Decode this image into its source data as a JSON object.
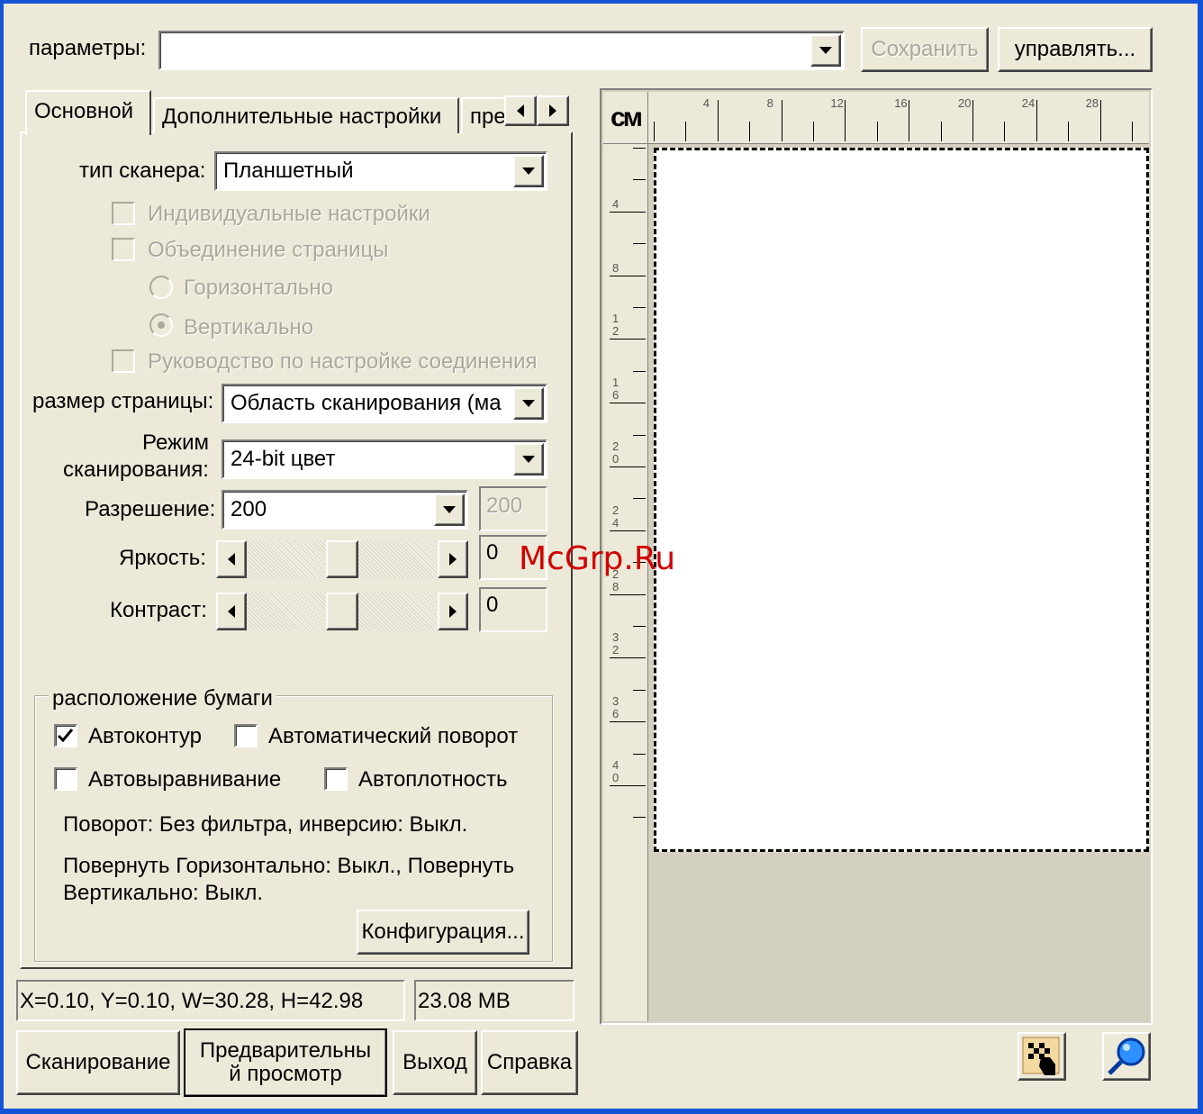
{
  "header": {
    "params_label": "параметры:",
    "params_value": "",
    "save_label": "Сохранить",
    "manage_label": "управлять..."
  },
  "tabs": [
    {
      "label": "Основной",
      "active": true
    },
    {
      "label": "Дополнительные настройки",
      "active": false
    },
    {
      "label": "пре",
      "active": false
    }
  ],
  "main": {
    "scanner_type_label": "тип сканера:",
    "scanner_type_value": "Планшетный",
    "individual_settings_label": "Индивидуальные настройки",
    "page_merge_label": "Объединение страницы",
    "horizontal_label": "Горизонтально",
    "vertical_label": "Вертикально",
    "connection_guide_label": "Руководство по настройке соединения",
    "page_size_label": "размер страницы:",
    "page_size_value": "Область сканирования (ма",
    "scan_mode_label_1": "Режим",
    "scan_mode_label_2": "сканирования:",
    "scan_mode_value": "24-bit цвет",
    "resolution_label": "Разрешение:",
    "resolution_value": "200",
    "resolution_custom": "200",
    "brightness_label": "Яркость:",
    "brightness_value": "0",
    "contrast_label": "Контраст:",
    "contrast_value": "0"
  },
  "paper": {
    "group_label": "расположение бумаги",
    "autocrop_label": "Автоконтур",
    "autocrop_checked": true,
    "autorotate_label": "Автоматический поворот",
    "autodeskew_label": "Автовыравнивание",
    "autodensity_label": "Автоплотность",
    "rotation_info": "Поворот: Без фильтра, инверсию: Выкл.",
    "flip_info_1": "Повернуть Горизонтально: Выкл., Повернуть",
    "flip_info_2": "Вертикально: Выкл.",
    "config_label": "Конфигурация..."
  },
  "status": {
    "coords": "X=0.10, Y=0.10, W=30.28, H=42.98",
    "size": "23.08 MB"
  },
  "buttons": {
    "scan": "Сканирование",
    "preview_1": "Предварительны",
    "preview_2": "й просмотр",
    "exit": "Выход",
    "help": "Справка"
  },
  "preview": {
    "unit": "см",
    "top_ruler_labels": [
      "4",
      "8",
      "12",
      "16",
      "20",
      "24",
      "28"
    ],
    "left_ruler_labels": [
      [
        "4"
      ],
      [
        "8"
      ],
      [
        "1",
        "2"
      ],
      [
        "1",
        "6"
      ],
      [
        "2",
        "0"
      ],
      [
        "2",
        "4"
      ],
      [
        "2",
        "8"
      ],
      [
        "3",
        "2"
      ],
      [
        "3",
        "6"
      ],
      [
        "4",
        "0"
      ]
    ],
    "watermark": "McGrp.Ru"
  },
  "tool_icons": [
    "hand-icon",
    "zoom-icon"
  ],
  "colors": {
    "desktop": "#1553d6",
    "window": "#ece9d8",
    "disabled_text": "#a9a899"
  }
}
